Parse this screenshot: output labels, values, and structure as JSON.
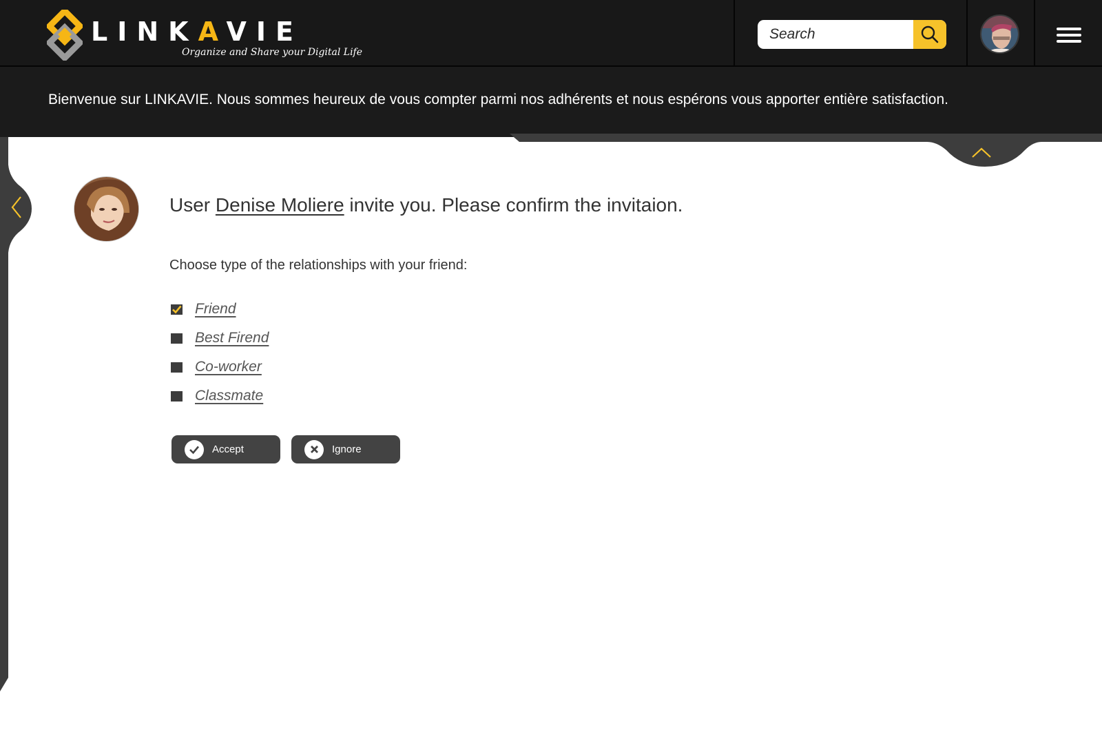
{
  "header": {
    "logo_word_start": "LINK",
    "logo_word_accent": "A",
    "logo_word_end": "VIE",
    "logo_tagline": "Organize and Share your Digital Life",
    "search": {
      "placeholder": "Search",
      "value": ""
    },
    "search_icon": "magnifier-icon",
    "menu_icon": "hamburger-icon"
  },
  "banner": {
    "text": "Bienvenue sur LINKAVIE. Nous sommes heureux de vous compter parmi nos adhérents et nous espérons vous apporter entière satisfaction."
  },
  "invite": {
    "prefix": "User ",
    "user_name": "Denise Moliere",
    "suffix": " invite you. Please confirm the invitaion.",
    "choose_label": "Choose type of the  relationships  with your friend:",
    "options": [
      {
        "label": "Friend",
        "checked": true
      },
      {
        "label": "Best Firend",
        "checked": false
      },
      {
        "label": "Co-worker",
        "checked": false
      },
      {
        "label": "Classmate",
        "checked": false
      }
    ],
    "accept_label": "Accept",
    "ignore_label": "Ignore"
  },
  "colors": {
    "accent": "#f6c22a",
    "header_bg": "#181818",
    "button_bg": "#434343"
  }
}
